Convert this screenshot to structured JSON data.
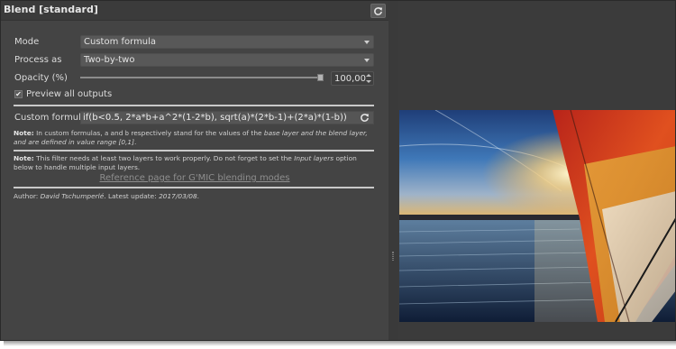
{
  "window": {
    "title": "Blend [standard]"
  },
  "form": {
    "mode_label": "Mode",
    "mode_value": "Custom formula",
    "process_label": "Process as",
    "process_value": "Two-by-two",
    "opacity_label": "Opacity (%)",
    "opacity_value": "100,00",
    "opacity_percent": 100,
    "preview_label": "Preview all outputs",
    "preview_checked": true,
    "formula_label": "Custom formula",
    "formula_value": "if(b<0.5, 2*a*b+a^2*(1-2*b), sqrt(a)*(2*b-1)+(2*a)*(1-b))"
  },
  "note1": {
    "bold": "Note:",
    "t1": " In custom formulas, ",
    "a": "a",
    "t2": " and ",
    "b": "b",
    "t3": " respectively stand for the values of the ",
    "i1": "base layer and the blend layer, and are defined in value range [0,1]",
    "t4": "."
  },
  "note2": {
    "bold": "Note:",
    "t1": " This filter needs at least two layers to work properly. Do not forget to set the ",
    "i1": "Input layers",
    "t2": " option below to handle multiple input layers."
  },
  "link": "Reference page for G'MIC blending modes",
  "author": {
    "prefix": "Author: ",
    "name": "David Tschumperlé",
    "mid": ". Latest update: ",
    "date": "2017/03/08",
    "end": "."
  },
  "icons": [
    "refresh-icon",
    "reset-icon",
    "check-icon",
    "chevron-down-icon",
    "splitter-grip-icon"
  ],
  "colors": {
    "panel": "#444444",
    "field": "#585858",
    "separator": "#c9c9c9",
    "link": "#8e8e8e"
  }
}
